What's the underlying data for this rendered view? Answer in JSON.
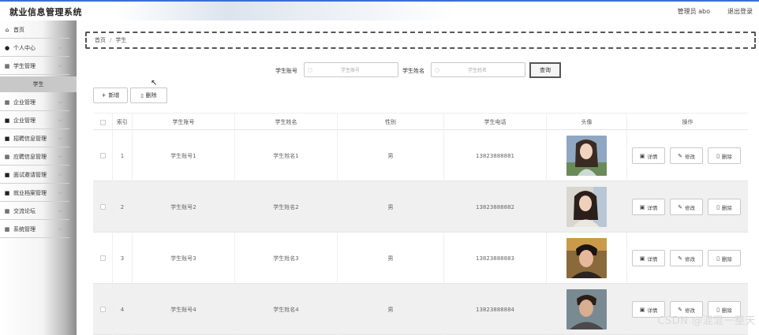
{
  "header": {
    "title": "就业信息管理系统",
    "user": "管理员 abo",
    "logout": "退出登录"
  },
  "sidebar": {
    "items": [
      {
        "label": "首页",
        "icon": "home-icon",
        "glyph": "⌂",
        "arrow": ""
      },
      {
        "label": "个人中心",
        "icon": "person-icon",
        "glyph": "●",
        "arrow": "⌵"
      },
      {
        "label": "学生管理",
        "icon": "grid-icon",
        "glyph": "▦",
        "arrow": "⌵"
      },
      {
        "label": "企业管理",
        "icon": "grid-icon",
        "glyph": "▦",
        "arrow": "⌵"
      },
      {
        "label": "企业管理",
        "icon": "document-icon",
        "glyph": "■",
        "arrow": "⌵"
      },
      {
        "label": "招聘信息管理",
        "icon": "document-icon",
        "glyph": "■",
        "arrow": "⌵"
      },
      {
        "label": "应聘信息管理",
        "icon": "grid-icon",
        "glyph": "▦",
        "arrow": "⌵"
      },
      {
        "label": "面试邀请管理",
        "icon": "document-icon",
        "glyph": "■",
        "arrow": "⌵"
      },
      {
        "label": "就业档案管理",
        "icon": "document-icon",
        "glyph": "■",
        "arrow": "⌵"
      },
      {
        "label": "交流论坛",
        "icon": "grid-icon",
        "glyph": "▦",
        "arrow": "⌵"
      },
      {
        "label": "系统管理",
        "icon": "grid-icon",
        "glyph": "▦",
        "arrow": "⌵"
      }
    ],
    "sub_item": "学生"
  },
  "breadcrumb": {
    "home": "首页",
    "separator": "/",
    "current": "学生"
  },
  "search": {
    "account_label": "学生账号",
    "account_placeholder": "学生账号",
    "name_label": "学生姓名",
    "name_placeholder": "学生姓名",
    "button": "查询"
  },
  "toolbar": {
    "add": "新增",
    "add_icon": "+",
    "delete": "删除",
    "delete_icon": "🗑"
  },
  "table": {
    "headers": [
      "",
      "索引",
      "学生账号",
      "学生姓名",
      "性别",
      "学生电话",
      "头像",
      "操作"
    ],
    "rows": [
      {
        "index": "1",
        "account": "学生账号1",
        "name": "学生姓名1",
        "gender": "男",
        "phone": "13823888881"
      },
      {
        "index": "2",
        "account": "学生账号2",
        "name": "学生姓名2",
        "gender": "男",
        "phone": "13823888882"
      },
      {
        "index": "3",
        "account": "学生账号3",
        "name": "学生姓名3",
        "gender": "男",
        "phone": "13823888883"
      },
      {
        "index": "4",
        "account": "学生账号4",
        "name": "学生姓名4",
        "gender": "男",
        "phone": "13823888884"
      }
    ],
    "actions": {
      "detail": "详情",
      "edit": "修改",
      "delete": "删除"
    }
  },
  "watermark": "CSDN @混混一整天",
  "colors": {
    "topbar_accent": "#3a6fcf",
    "row_alt": "#f0f0f0"
  }
}
